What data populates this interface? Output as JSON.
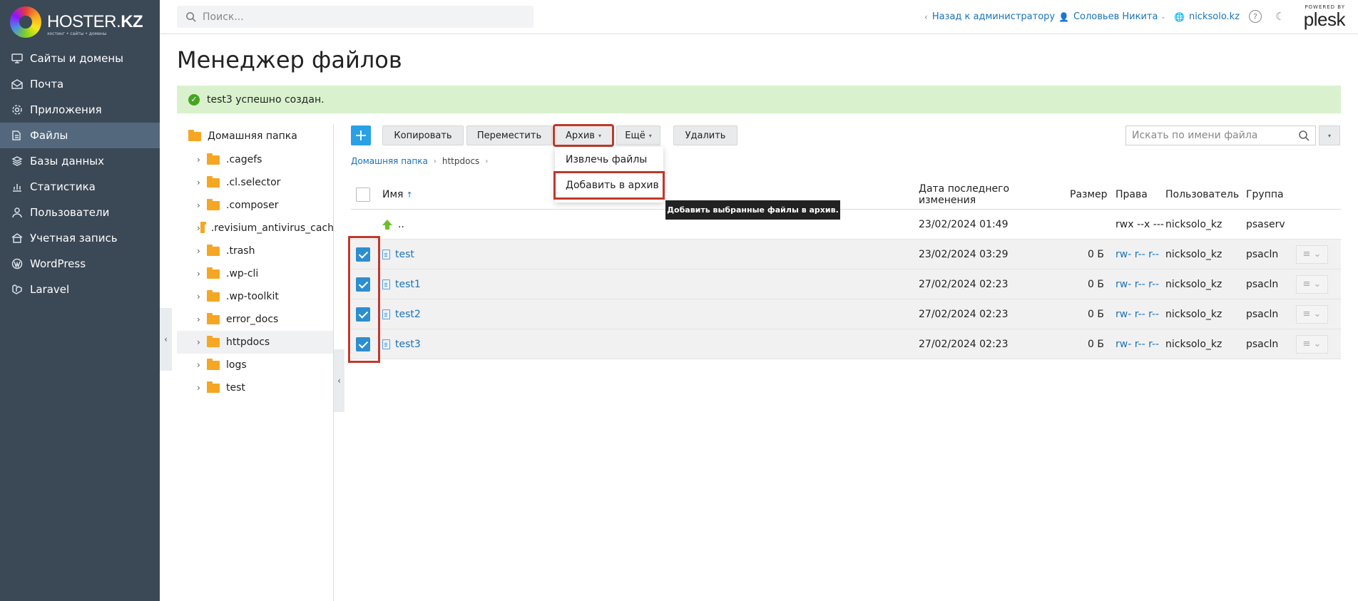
{
  "brand": {
    "name_part1": "HOSTER.",
    "name_part2": "KZ",
    "tagline": "хостинг • сайты • домены"
  },
  "sidebar": {
    "items": [
      {
        "label": "Сайты и домены",
        "icon": "monitor-icon"
      },
      {
        "label": "Почта",
        "icon": "mail-icon"
      },
      {
        "label": "Приложения",
        "icon": "gear-icon"
      },
      {
        "label": "Файлы",
        "icon": "file-icon",
        "active": true
      },
      {
        "label": "Базы данных",
        "icon": "database-icon"
      },
      {
        "label": "Статистика",
        "icon": "chart-icon"
      },
      {
        "label": "Пользователи",
        "icon": "user-icon"
      },
      {
        "label": "Учетная запись",
        "icon": "account-icon"
      },
      {
        "label": "WordPress",
        "icon": "wordpress-icon"
      },
      {
        "label": "Laravel",
        "icon": "laravel-icon"
      }
    ]
  },
  "header": {
    "search_placeholder": "Поиск...",
    "back_link": "Назад к администратору",
    "user_name": "Соловьев Никита",
    "domain": "nicksolo.kz",
    "powered_by": "POWERED BY",
    "plesk": "plesk"
  },
  "page": {
    "title": "Менеджер файлов",
    "alert": "test3 успешно создан."
  },
  "tree": {
    "root": "Домашняя папка",
    "items": [
      ".cagefs",
      ".cl.selector",
      ".composer",
      ".revisium_antivirus_cach",
      ".trash",
      ".wp-cli",
      ".wp-toolkit",
      "error_docs",
      "httpdocs",
      "logs",
      "test"
    ],
    "selected": "httpdocs"
  },
  "toolbar": {
    "add": "+",
    "copy": "Копировать",
    "move": "Переместить",
    "archive": "Архив",
    "more": "Ещё",
    "delete": "Удалить",
    "file_search_placeholder": "Искать по имени файла"
  },
  "archive_menu": {
    "extract": "Извлечь файлы",
    "add": "Добавить в архив",
    "tooltip": "Добавить выбранные файлы в архив."
  },
  "breadcrumb": {
    "home": "Домашняя папка",
    "current": "httpdocs"
  },
  "table": {
    "headers": {
      "name": "Имя",
      "sort_arrow": "↑",
      "modified": "Дата последнего изменения",
      "size": "Размер",
      "perms": "Права",
      "user": "Пользователь",
      "group": "Группа"
    },
    "parent": {
      "name": "..",
      "modified": "23/02/2024 01:49",
      "perms": "rwx --x ---",
      "user": "nicksolo_kz",
      "group": "psaserv"
    },
    "rows": [
      {
        "name": "test",
        "modified": "23/02/2024 03:29",
        "size": "0 Б",
        "perms": "rw- r-- r--",
        "user": "nicksolo_kz",
        "group": "psacln",
        "checked": true
      },
      {
        "name": "test1",
        "modified": "27/02/2024 02:23",
        "size": "0 Б",
        "perms": "rw- r-- r--",
        "user": "nicksolo_kz",
        "group": "psacln",
        "checked": true
      },
      {
        "name": "test2",
        "modified": "27/02/2024 02:23",
        "size": "0 Б",
        "perms": "rw- r-- r--",
        "user": "nicksolo_kz",
        "group": "psacln",
        "checked": true
      },
      {
        "name": "test3",
        "modified": "27/02/2024 02:23",
        "size": "0 Б",
        "perms": "rw- r-- r--",
        "user": "nicksolo_kz",
        "group": "psacln",
        "checked": true
      }
    ]
  }
}
